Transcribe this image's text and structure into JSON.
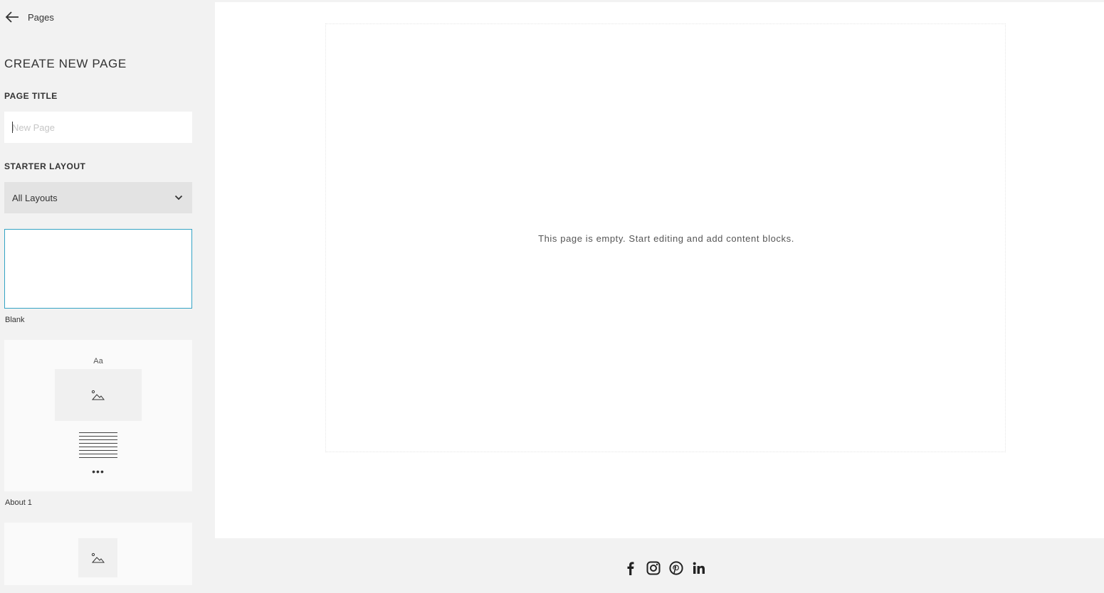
{
  "sidebar": {
    "back_label": "Pages",
    "heading": "CREATE NEW PAGE",
    "page_title_label": "PAGE TITLE",
    "page_title_placeholder": "New Page",
    "starter_layout_label": "STARTER LAYOUT",
    "layout_select_value": "All Layouts",
    "layouts": [
      {
        "label": "Blank"
      },
      {
        "label": "About 1",
        "heading_glyph": "Aa",
        "more": "•••"
      },
      {
        "label": ""
      }
    ]
  },
  "preview": {
    "empty_message": "This page is empty. Start editing and add content blocks."
  },
  "footer": {
    "social_icons": [
      "facebook-icon",
      "instagram-icon",
      "pinterest-icon",
      "linkedin-icon"
    ]
  },
  "colors": {
    "selected_border": "#34a3c4",
    "sidebar_bg": "#f2f2f2"
  }
}
